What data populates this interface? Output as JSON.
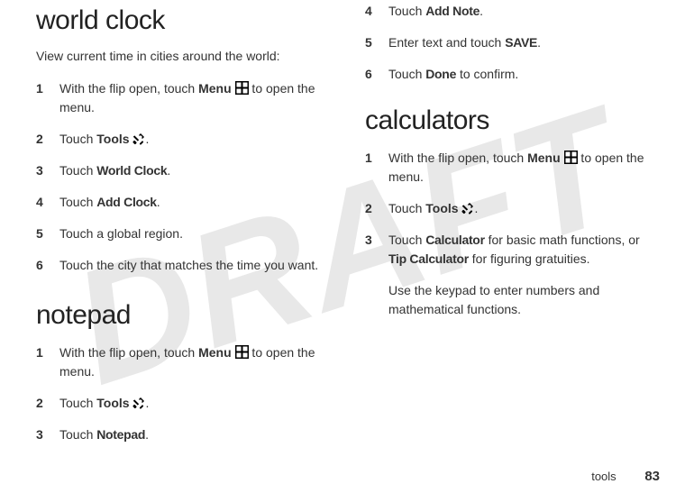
{
  "watermark": "DRAFT",
  "left": {
    "section1": {
      "heading": "world clock",
      "intro": "View current time in cities around the world:",
      "steps": [
        {
          "n": "1",
          "pre": "With the flip open, touch ",
          "b1": "Menu",
          "icon": "menu",
          "post": " to open the menu."
        },
        {
          "n": "2",
          "pre": "Touch ",
          "b1": "Tools",
          "icon": "tools",
          "post": "."
        },
        {
          "n": "3",
          "pre": "Touch ",
          "c1": "World Clock",
          "post": "."
        },
        {
          "n": "4",
          "pre": "Touch ",
          "c1": "Add Clock",
          "post": "."
        },
        {
          "n": "5",
          "pre": "Touch a global region."
        },
        {
          "n": "6",
          "pre": "Touch the city that matches the time you want."
        }
      ]
    },
    "section2": {
      "heading": "notepad",
      "steps": [
        {
          "n": "1",
          "pre": "With the flip open, touch ",
          "b1": "Menu",
          "icon": "menu",
          "post": " to open the menu."
        },
        {
          "n": "2",
          "pre": "Touch ",
          "b1": "Tools",
          "icon": "tools",
          "post": "."
        },
        {
          "n": "3",
          "pre": "Touch ",
          "c1": "Notepad",
          "post": "."
        }
      ]
    }
  },
  "right": {
    "cont_steps": [
      {
        "n": "4",
        "pre": "Touch ",
        "c1": "Add Note",
        "post": "."
      },
      {
        "n": "5",
        "pre": "Enter text and touch ",
        "c1": "SAVE",
        "post": "."
      },
      {
        "n": "6",
        "pre": "Touch ",
        "c1": "Done",
        "post": " to confirm."
      }
    ],
    "section3": {
      "heading": "calculators",
      "steps": [
        {
          "n": "1",
          "pre": "With the flip open, touch ",
          "b1": "Menu",
          "icon": "menu",
          "post": " to open the menu."
        },
        {
          "n": "2",
          "pre": "Touch ",
          "b1": "Tools",
          "icon": "tools",
          "post": "."
        },
        {
          "n": "3",
          "pre": "Touch ",
          "c1": "Calculator",
          "mid": " for basic math functions, or ",
          "c2": "Tip Calculator",
          "post": " for figuring gratuities."
        }
      ],
      "extra": "Use the keypad to enter numbers and mathematical functions."
    }
  },
  "footer": {
    "label": "tools",
    "page": "83"
  }
}
